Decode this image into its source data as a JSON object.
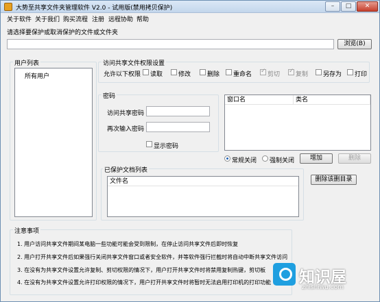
{
  "window": {
    "title": "大势至共享文件夹管理软件 V2.0 - 试用版(禁用拷贝保护)",
    "minimize": "–",
    "maximize": "□",
    "close": "✕"
  },
  "menu": [
    "关于软件",
    "关于我们",
    "购买流程",
    "注册",
    "远程协助",
    "帮助"
  ],
  "path": {
    "prompt": "请选择要保护或取消保护的文件或文件夹",
    "value": "",
    "browse_label": "浏览(B)"
  },
  "users": {
    "title": "用户列表",
    "items": [
      "所有用户"
    ]
  },
  "permissions": {
    "title": "访问共享文件权限设置",
    "allow_label": "允许以下权限",
    "options": [
      {
        "label": "读取",
        "checked": false,
        "enabled": true
      },
      {
        "label": "修改",
        "checked": false,
        "enabled": true
      },
      {
        "label": "删除",
        "checked": false,
        "enabled": true
      },
      {
        "label": "重命名",
        "checked": false,
        "enabled": true
      },
      {
        "label": "剪切",
        "checked": true,
        "enabled": false
      },
      {
        "label": "复制",
        "checked": true,
        "enabled": false
      },
      {
        "label": "另存为",
        "checked": false,
        "enabled": true
      },
      {
        "label": "打印",
        "checked": false,
        "enabled": true
      }
    ]
  },
  "password": {
    "title": "密码",
    "access_label": "访问共享密码",
    "access_value": "",
    "confirm_label": "再次输入密码",
    "confirm_value": "",
    "show_label": "显示密码"
  },
  "windows_table": {
    "columns": [
      "窗口名",
      "类名"
    ],
    "rows": []
  },
  "close_mode": {
    "options": [
      "常规关闭",
      "强制关闭"
    ],
    "selected": "常规关闭"
  },
  "actions": {
    "add_label": "增加",
    "remove_label": "删除",
    "remove_deleted_label": "删除该删目录"
  },
  "protected": {
    "title": "已保护文档列表",
    "column": "文件名",
    "rows": []
  },
  "notes": {
    "title": "注意事项",
    "lines": [
      "1. 用户访问共享文件期间某电脑一些功能可能会受到限制，在停止访问共享文件后即时恢复",
      "2. 用户打开共享文件后如果强行关闭共享文件窗口或者安全软件，并等软件强行拦截时将自动中断共享文件访问",
      "3. 在没有为共享文件设置允许复制、剪切权限的情况下，用户打开共享文件时将禁用复制热键，剪切板",
      "4. 在没有为共享文件设置允许打印权限的情况下，用户打开共享文件时将暂时无法启用打印机的打印功能"
    ]
  },
  "watermark": {
    "icon": "info-badge-icon",
    "text": "知识屋",
    "sub": "zhishiwu.com"
  }
}
